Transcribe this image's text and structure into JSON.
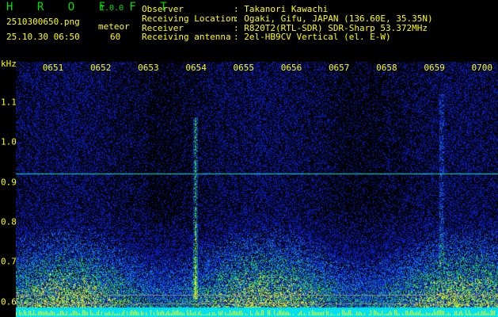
{
  "app": {
    "name": "H R O F F T",
    "version": "1.0.0"
  },
  "file": {
    "name": "2510300650.png",
    "datetime": "25.10.30 06:50"
  },
  "meteor": {
    "label": "meteor",
    "count": "60"
  },
  "info": [
    {
      "label": "Observer",
      "value": ": Takanori Kawachi"
    },
    {
      "label": "Receiving Location",
      "value": ": Ogaki, Gifu, JAPAN (136.60E, 35.35N)"
    },
    {
      "label": "Receiver",
      "value": ": R820T2(RTL-SDR) SDR-Sharp 53.372MHz"
    },
    {
      "label": "Receiving antenna",
      "value": ": 2el-HB9CV Vertical (el. E-W)"
    }
  ],
  "axis": {
    "y_unit": "kHz",
    "y_ticks": [
      "1.1",
      "1.0",
      "0.9",
      "0.8",
      "0.7",
      "0.6"
    ],
    "x_ticks": [
      "0651",
      "0652",
      "0653",
      "0654",
      "0655",
      "0656",
      "0657",
      "0658",
      "0659",
      "0700"
    ]
  },
  "colors": {
    "text": "#ffff00",
    "logo": "#00e000",
    "marker_line": "#00e0c0",
    "noise": "#1020c0"
  }
}
